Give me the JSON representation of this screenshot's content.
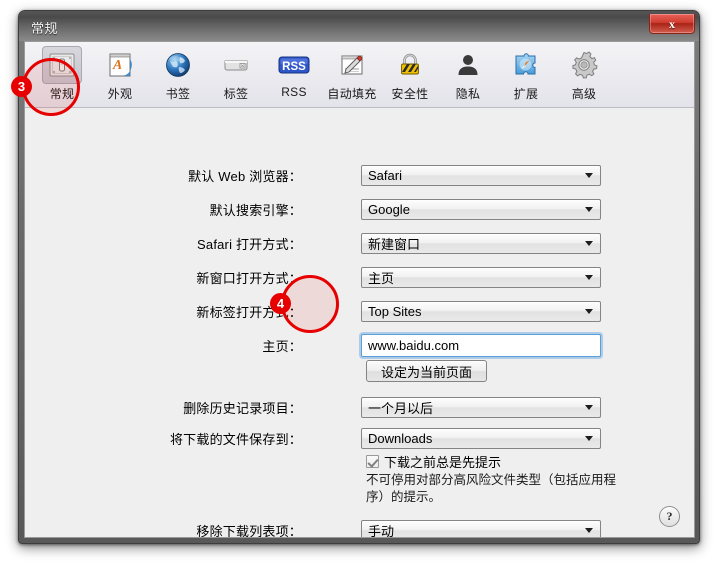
{
  "window": {
    "title": "常规",
    "close_label": "✕"
  },
  "toolbar": {
    "items": [
      {
        "label": "常规",
        "icon": "general-switchplate-icon",
        "selected": true
      },
      {
        "label": "外观",
        "icon": "appearance-font-icon",
        "selected": false
      },
      {
        "label": "书签",
        "icon": "bookmarks-globe-icon",
        "selected": false
      },
      {
        "label": "标签",
        "icon": "tabs-icon",
        "selected": false
      },
      {
        "label": "RSS",
        "icon": "rss-badge-icon",
        "selected": false
      },
      {
        "label": "自动填充",
        "icon": "autofill-pencil-icon",
        "selected": false
      },
      {
        "label": "安全性",
        "icon": "security-padlock-icon",
        "selected": false
      },
      {
        "label": "隐私",
        "icon": "privacy-person-icon",
        "selected": false
      },
      {
        "label": "扩展",
        "icon": "extensions-puzzle-icon",
        "selected": false
      },
      {
        "label": "高级",
        "icon": "advanced-gear-icon",
        "selected": false
      }
    ]
  },
  "form": {
    "default_browser": {
      "label": "默认 Web 浏览器：",
      "value": "Safari"
    },
    "default_search": {
      "label": "默认搜索引擎：",
      "value": "Google"
    },
    "safari_opens_with": {
      "label": "Safari 打开方式：",
      "value": "新建窗口"
    },
    "new_window_opens": {
      "label": "新窗口打开方式：",
      "value": "主页"
    },
    "new_tab_opens": {
      "label": "新标签打开方式：",
      "value": "Top Sites"
    },
    "homepage": {
      "label": "主页：",
      "value": "www.baidu.com",
      "placeholder": ""
    },
    "set_current_page_button": "设定为当前页面",
    "remove_history": {
      "label": "删除历史记录项目：",
      "value": "一个月以后"
    },
    "save_downloads_to": {
      "label": "将下载的文件保存到：",
      "value": "Downloads"
    },
    "always_prompt": {
      "label": "下载之前总是先提示",
      "checked": true
    },
    "prompt_hint": "不可停用对部分高风险文件类型（包括应用程序）的提示。",
    "remove_download_items": {
      "label": "移除下载列表项：",
      "value": "手动"
    }
  },
  "help": {
    "label": "?"
  },
  "annotations": {
    "step3": {
      "number": "3",
      "target": "toolbar-item-general"
    },
    "step4": {
      "number": "4",
      "target": "homepage-label"
    }
  },
  "colors": {
    "annotation_red": "#e60000",
    "focus_blue": "#5a9fd8",
    "titlebar_gray": "#6a6a6a"
  }
}
